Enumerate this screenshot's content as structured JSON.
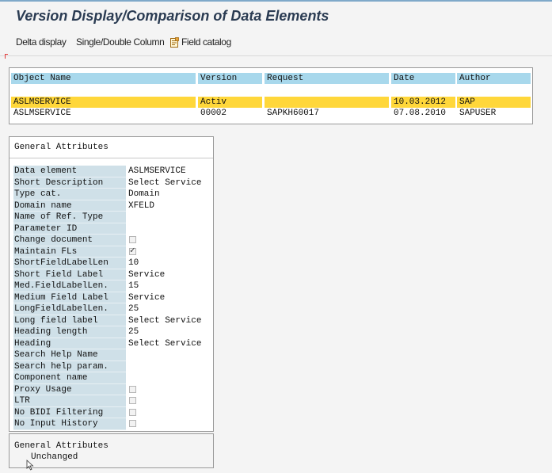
{
  "title": "Version Display/Comparison of Data Elements",
  "toolbar": {
    "delta_display": "Delta display",
    "single_double": "Single/Double Column",
    "field_catalog": "Field catalog"
  },
  "versions": {
    "headers": [
      "Object Name",
      "Version",
      "Request",
      "Date",
      "Author"
    ],
    "rows": [
      {
        "object": "ASLMSERVICE",
        "version": "Activ",
        "request": "",
        "date": "10.03.2012",
        "author": "SAP"
      },
      {
        "object": "ASLMSERVICE",
        "version": "00002",
        "request": "SAPKH60017",
        "date": "07.08.2010",
        "author": "SAPUSER"
      }
    ]
  },
  "attributes": {
    "heading": "General Attributes",
    "rows": [
      {
        "label": "Data element",
        "value": "ASLMSERVICE"
      },
      {
        "label": "Short Description",
        "value": "Select Service"
      },
      {
        "label": "Type cat.",
        "value": "Domain"
      },
      {
        "label": "Domain name",
        "value": "XFELD"
      },
      {
        "label": "Name of Ref. Type",
        "value": ""
      },
      {
        "label": "Parameter ID",
        "value": ""
      },
      {
        "label": "Change document",
        "value": "",
        "checkbox": true,
        "checked": false
      },
      {
        "label": "Maintain FLs",
        "value": "",
        "checkbox": true,
        "checked": true
      },
      {
        "label": "ShortFieldLabelLen",
        "value": "10"
      },
      {
        "label": "Short Field Label",
        "value": "Service"
      },
      {
        "label": "Med.FieldLabelLen.",
        "value": "15"
      },
      {
        "label": "Medium Field Label",
        "value": "Service"
      },
      {
        "label": "LongFieldLabelLen.",
        "value": "25"
      },
      {
        "label": "Long field label",
        "value": "Select Service"
      },
      {
        "label": "Heading length",
        "value": "25"
      },
      {
        "label": "Heading",
        "value": "Select Service"
      },
      {
        "label": "Search Help Name",
        "value": ""
      },
      {
        "label": "Search help param.",
        "value": ""
      },
      {
        "label": "Component name",
        "value": ""
      },
      {
        "label": "Proxy Usage",
        "value": "",
        "checkbox": true,
        "checked": false
      },
      {
        "label": "LTR",
        "value": "",
        "checkbox": true,
        "checked": false
      },
      {
        "label": "No BIDI Filtering",
        "value": "",
        "checkbox": true,
        "checked": false
      },
      {
        "label": "No Input History",
        "value": "",
        "checkbox": true,
        "checked": false
      }
    ]
  },
  "footer": {
    "heading": "General Attributes",
    "status": "Unchanged"
  },
  "colors": {
    "header_bg": "#a8d8ec",
    "active_row_bg": "#ffd73a",
    "label_bg": "#cfe0e8",
    "title": "#2a3b52"
  },
  "icons": [
    "field-catalog-icon",
    "mouse-cursor-icon"
  ]
}
